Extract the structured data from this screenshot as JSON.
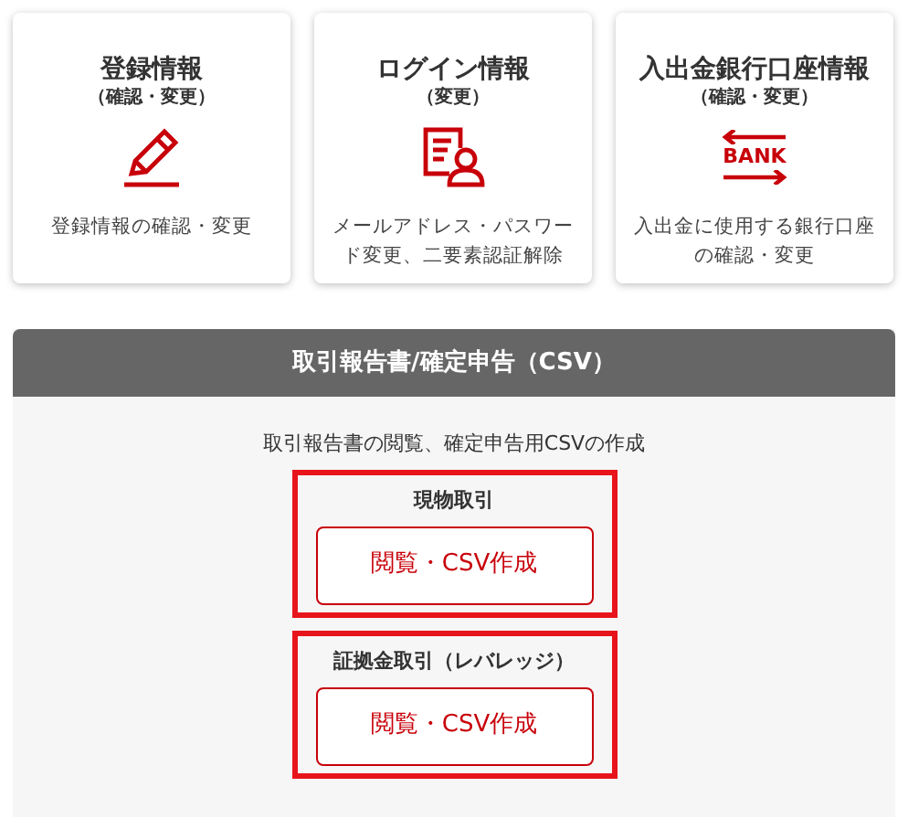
{
  "cards": [
    {
      "kind": "pencil",
      "title": "登録情報",
      "subtitle": "（確認・変更）",
      "description": "登録情報の確認・変更"
    },
    {
      "kind": "profile",
      "title": "ログイン情報",
      "subtitle": "（変更）",
      "description": "メールアドレス・パスワード変更、二要素認証解除"
    },
    {
      "kind": "bank",
      "title": "入出金銀行口座情報",
      "subtitle": "（確認・変更）",
      "icon_label": "BANK",
      "description": "入出金に使用する銀行口座の確認・変更"
    }
  ],
  "section": {
    "title": "取引報告書/確定申告（CSV）",
    "description": "取引報告書の閲覧、確定申告用CSVの作成",
    "groups": [
      {
        "label": "現物取引",
        "button": "閲覧・CSV作成"
      },
      {
        "label": "証拠金取引（レバレッジ）",
        "button": "閲覧・CSV作成"
      }
    ]
  }
}
